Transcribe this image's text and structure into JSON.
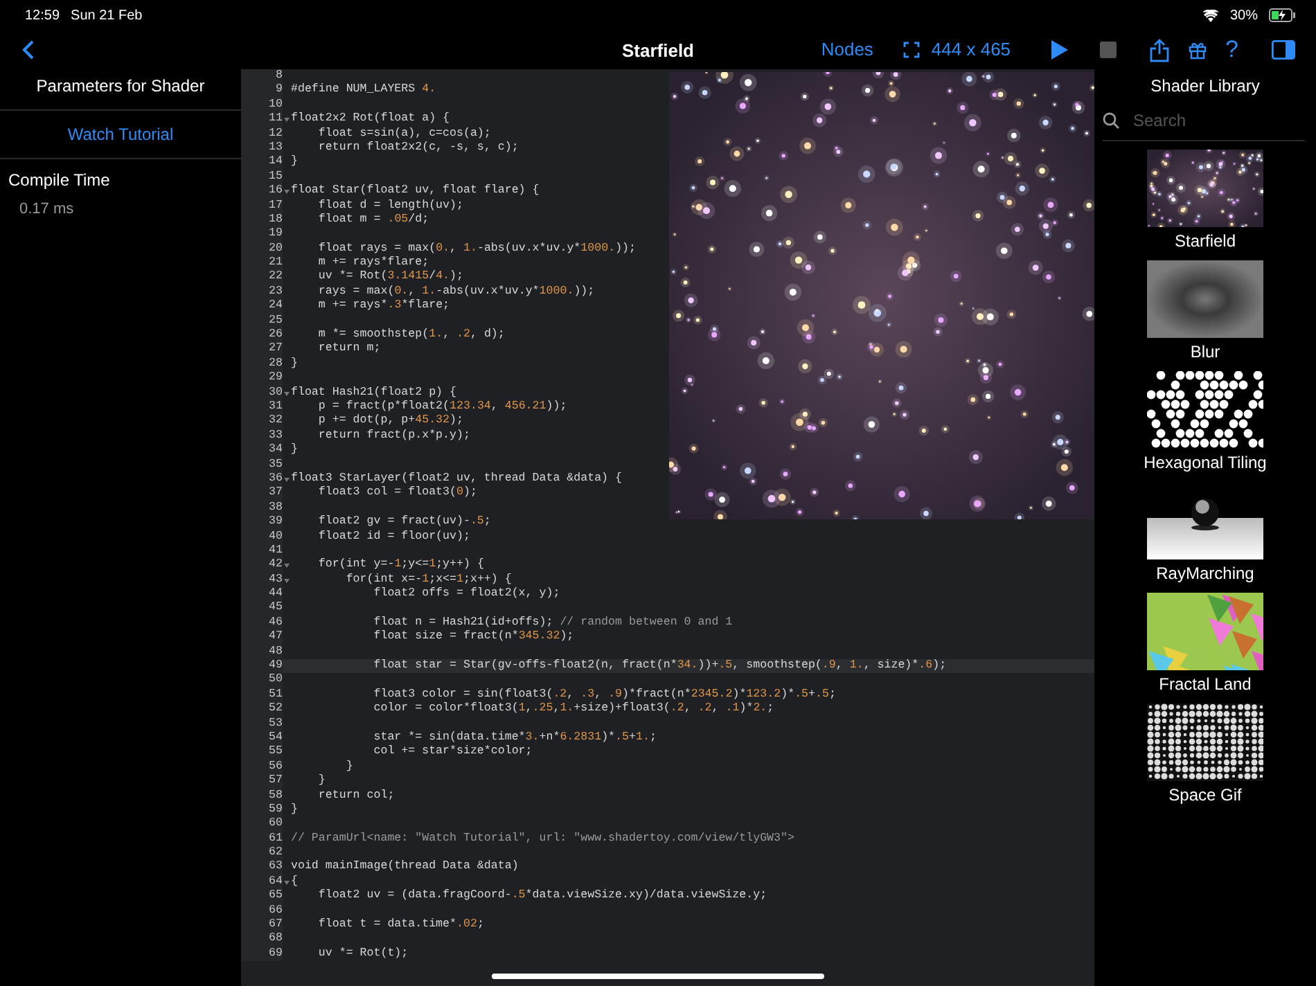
{
  "status_bar": {
    "time": "12:59",
    "date": "Sun 21 Feb",
    "battery": "30%"
  },
  "nav": {
    "title": "Starfield",
    "nodes": "Nodes",
    "size": "444 x 465",
    "help": "?",
    "playing": false
  },
  "parameters": {
    "title": "Parameters for Shader",
    "link": "Watch Tutorial",
    "compile_label": "Compile Time",
    "compile_value": "0.17 ms"
  },
  "code": [
    {
      "n": "8",
      "foldable": false,
      "highlighted": false
    },
    {
      "n": "9",
      "code": "#define NUM_LAYERS 4.",
      "foldable": false,
      "highlighted": false
    },
    {
      "n": "10",
      "foldable": false,
      "highlighted": false
    },
    {
      "n": "11",
      "code": "float2x2 Rot(float a) {",
      "foldable": true,
      "highlighted": false
    },
    {
      "n": "12",
      "code": "    float s=sin(a), c=cos(a);",
      "foldable": false,
      "highlighted": false
    },
    {
      "n": "13",
      "code": "    return float2x2(c, -s, s, c);",
      "foldable": false,
      "highlighted": false
    },
    {
      "n": "14",
      "code": "}",
      "foldable": false,
      "highlighted": false
    },
    {
      "n": "15",
      "foldable": false,
      "highlighted": false
    },
    {
      "n": "16",
      "code": "float Star(float2 uv, float flare) {",
      "foldable": true,
      "highlighted": false
    },
    {
      "n": "17",
      "code": "    float d = length(uv);",
      "foldable": false,
      "highlighted": false
    },
    {
      "n": "18",
      "code": "    float m = .05/d;",
      "foldable": false,
      "highlighted": false
    },
    {
      "n": "19",
      "foldable": false,
      "highlighted": false
    },
    {
      "n": "20",
      "code": "    float rays = max(0., 1.-abs(uv.x*uv.y*1000.));",
      "foldable": false,
      "highlighted": false
    },
    {
      "n": "21",
      "code": "    m += rays*flare;",
      "foldable": false,
      "highlighted": false
    },
    {
      "n": "22",
      "code": "    uv *= Rot(3.1415/4.);",
      "foldable": false,
      "highlighted": false
    },
    {
      "n": "23",
      "code": "    rays = max(0., 1.-abs(uv.x*uv.y*1000.));",
      "foldable": false,
      "highlighted": false
    },
    {
      "n": "24",
      "code": "    m += rays*.3*flare;",
      "foldable": false,
      "highlighted": false
    },
    {
      "n": "25",
      "foldable": false,
      "highlighted": false
    },
    {
      "n": "26",
      "code": "    m *= smoothstep(1., .2, d);",
      "foldable": false,
      "highlighted": false
    },
    {
      "n": "27",
      "code": "    return m;",
      "foldable": false,
      "highlighted": false
    },
    {
      "n": "28",
      "code": "}",
      "foldable": false,
      "highlighted": false
    },
    {
      "n": "29",
      "foldable": false,
      "highlighted": false
    },
    {
      "n": "30",
      "code": "float Hash21(float2 p) {",
      "foldable": true,
      "highlighted": false
    },
    {
      "n": "31",
      "code": "    p = fract(p*float2(123.34, 456.21));",
      "foldable": false,
      "highlighted": false
    },
    {
      "n": "32",
      "code": "    p += dot(p, p+45.32);",
      "foldable": false,
      "highlighted": false
    },
    {
      "n": "33",
      "code": "    return fract(p.x*p.y);",
      "foldable": false,
      "highlighted": false
    },
    {
      "n": "34",
      "code": "}",
      "foldable": false,
      "highlighted": false
    },
    {
      "n": "35",
      "foldable": false,
      "highlighted": false
    },
    {
      "n": "36",
      "code": "float3 StarLayer(float2 uv, thread Data &data) {",
      "foldable": true,
      "highlighted": false
    },
    {
      "n": "37",
      "code": "    float3 col = float3(0);",
      "foldable": false,
      "highlighted": false
    },
    {
      "n": "38",
      "foldable": false,
      "highlighted": false
    },
    {
      "n": "39",
      "code": "    float2 gv = fract(uv)-.5;",
      "foldable": false,
      "highlighted": false
    },
    {
      "n": "40",
      "code": "    float2 id = floor(uv);",
      "foldable": false,
      "highlighted": false
    },
    {
      "n": "41",
      "foldable": false,
      "highlighted": false
    },
    {
      "n": "42",
      "code": "    for(int y=-1;y<=1;y++) {",
      "foldable": true,
      "highlighted": false
    },
    {
      "n": "43",
      "code": "        for(int x=-1;x<=1;x++) {",
      "foldable": true,
      "highlighted": false
    },
    {
      "n": "44",
      "code": "            float2 offs = float2(x, y);",
      "foldable": false,
      "highlighted": false
    },
    {
      "n": "45",
      "foldable": false,
      "highlighted": false
    },
    {
      "n": "46",
      "code": "            float n = Hash21(id+offs); // random between 0 and 1",
      "foldable": false,
      "highlighted": false
    },
    {
      "n": "47",
      "code": "            float size = fract(n*345.32);",
      "foldable": false,
      "highlighted": false
    },
    {
      "n": "48",
      "foldable": false,
      "highlighted": false
    },
    {
      "n": "49",
      "code": "            float star = Star(gv-offs-float2(n, fract(n*34.))+.5, smoothstep(.9, 1., size)*.6);",
      "foldable": false,
      "highlighted": true
    },
    {
      "n": "50",
      "foldable": false,
      "highlighted": false
    },
    {
      "n": "51",
      "code": "            float3 color = sin(float3(.2, .3, .9)*fract(n*2345.2)*123.2)*.5+.5;",
      "foldable": false,
      "highlighted": false
    },
    {
      "n": "52",
      "code": "            color = color*float3(1,.25,1.+size)+float3(.2, .2, .1)*2.;",
      "foldable": false,
      "highlighted": false
    },
    {
      "n": "53",
      "foldable": false,
      "highlighted": false
    },
    {
      "n": "54",
      "code": "            star *= sin(data.time*3.+n*6.2831)*.5+1.;",
      "foldable": false,
      "highlighted": false
    },
    {
      "n": "55",
      "code": "            col += star*size*color;",
      "foldable": false,
      "highlighted": false
    },
    {
      "n": "56",
      "code": "        }",
      "foldable": false,
      "highlighted": false
    },
    {
      "n": "57",
      "code": "    }",
      "foldable": false,
      "highlighted": false
    },
    {
      "n": "58",
      "code": "    return col;",
      "foldable": false,
      "highlighted": false
    },
    {
      "n": "59",
      "code": "}",
      "foldable": false,
      "highlighted": false
    },
    {
      "n": "60",
      "foldable": false,
      "highlighted": false
    },
    {
      "n": "61",
      "code": "// ParamUrl<name: \"Watch Tutorial\", url: \"www.shadertoy.com/view/tlyGW3\">",
      "foldable": false,
      "highlighted": false
    },
    {
      "n": "62",
      "foldable": false,
      "highlighted": false
    },
    {
      "n": "63",
      "code": "void mainImage(thread Data &data)",
      "foldable": false,
      "highlighted": false
    },
    {
      "n": "64",
      "code": "{",
      "foldable": true,
      "highlighted": false
    },
    {
      "n": "65",
      "code": "    float2 uv = (data.fragCoord-.5*data.viewSize.xy)/data.viewSize.y;",
      "foldable": false,
      "highlighted": false
    },
    {
      "n": "66",
      "foldable": false,
      "highlighted": false
    },
    {
      "n": "67",
      "code": "    float t = data.time*.02;",
      "foldable": false,
      "highlighted": false
    },
    {
      "n": "68",
      "foldable": false,
      "highlighted": false
    },
    {
      "n": "69",
      "code": "    uv *= Rot(t);",
      "foldable": false,
      "highlighted": false
    }
  ],
  "library": {
    "title": "Shader Library",
    "search": {
      "placeholder": "Search"
    },
    "items": [
      {
        "name": "Starfield",
        "kind": "stars"
      },
      {
        "name": "Blur",
        "kind": "blur"
      },
      {
        "name": "Hexagonal Tiling",
        "kind": "hexagons"
      },
      {
        "name": "RayMarching",
        "kind": "sphere"
      },
      {
        "name": "Fractal Land",
        "kind": "fractal"
      },
      {
        "name": "Space Gif",
        "kind": "dots"
      }
    ]
  }
}
